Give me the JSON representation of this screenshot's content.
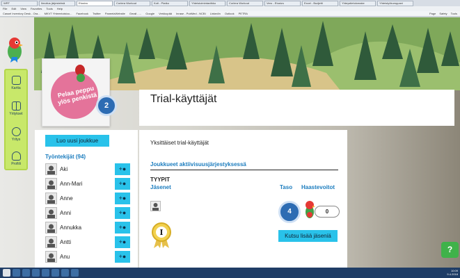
{
  "browser": {
    "tabs": [
      "WRT",
      "Ilmoitus järjestelmä",
      "Etusivu",
      "Corlera Workout",
      "Koti - Piwiko",
      "Yhteistoimintaviikko",
      "Corlera Workout",
      "Vero - Etusivu",
      "Excel - Budjetti",
      "Yhteystietolomake",
      "Yhteistyökumppani"
    ],
    "menu": [
      "File",
      "Edit",
      "View",
      "Favorites",
      "Tools",
      "Help"
    ],
    "favorites": [
      "Cassel Inventory Desk - Ora...",
      "MKVT Yhteentoistoo...",
      "Facebook",
      "Twitter",
      "PaneelaWebsite",
      "Gmail - ...",
      "Google",
      "Verkkopää",
      "Inrase - PubMed - NCBI",
      "LinkedIn",
      "Outlook",
      "PETRA"
    ],
    "toolbar_right": [
      "Page",
      "Safety",
      "Tools"
    ]
  },
  "sidebar": {
    "items": [
      {
        "label": "Kartta",
        "icon": "map-icon"
      },
      {
        "label": "Yritykset",
        "icon": "grid-icon"
      },
      {
        "label": "Yritys",
        "icon": "people-icon"
      },
      {
        "label": "Profiili",
        "icon": "profile-icon"
      }
    ]
  },
  "profile": {
    "logo_line1": "Pelaa peppu",
    "logo_line2": "ylös penkistä",
    "badge_count": "2"
  },
  "page_title": "Trial-käyttäjät",
  "left": {
    "create_group_button": "Luo uusi joukkue",
    "employees_heading": "Työntekijät (94)",
    "employees": [
      {
        "name": "Aki"
      },
      {
        "name": "Ann-Mari"
      },
      {
        "name": "Anne"
      },
      {
        "name": "Anni"
      },
      {
        "name": "Annukka"
      },
      {
        "name": "Antti"
      },
      {
        "name": "Anu"
      }
    ],
    "add_icon": "add-user-icon"
  },
  "right": {
    "subtitle": "Yksittäiset trial-käyttäjät",
    "active_groups": "Joukkueet aktiivisuusjärjestyksessä",
    "type_label": "TYYPIT",
    "members_label": "Jäsenet",
    "level_label": "Taso",
    "challenge_label": "Haastevoitot",
    "level_value": "4",
    "challenge_wins": "0",
    "invite_button": "Kutsu lisää jäseniä"
  },
  "colors": {
    "accent": "#29c2ea",
    "sidebar": "#c8e86a",
    "heading": "#1b7cbe",
    "badge": "#2d6cb3"
  },
  "help": {
    "label": "?"
  },
  "clock": {
    "time": "10:09",
    "date": "9.4.2018"
  }
}
